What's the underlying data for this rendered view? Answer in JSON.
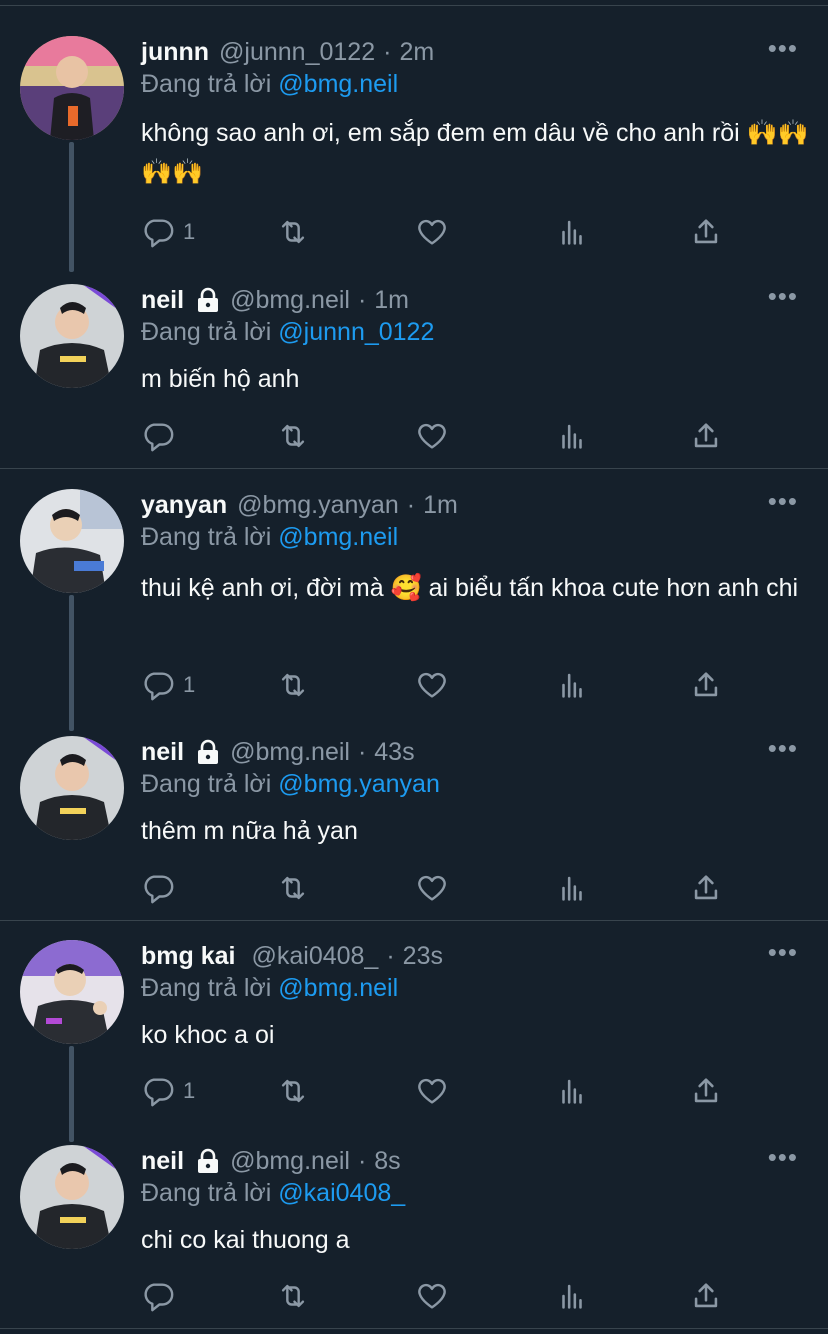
{
  "tweets": [
    {
      "name": "junnn",
      "locked": false,
      "handle": "@junnn_0122",
      "time": "2m",
      "reply_prefix": "Đang trả lời",
      "reply_to": "@bmg.neil",
      "text": "không sao anh ơi, em sắp đem em dâu về cho anh rồi 🙌🙌🙌🙌",
      "reply_count": "1",
      "avatar_colors": [
        "#d9c38f",
        "#5a3f7a",
        "#e86a2b"
      ]
    },
    {
      "name": "neil",
      "locked": true,
      "handle": "@bmg.neil",
      "time": "1m",
      "reply_prefix": "Đang trả lời",
      "reply_to": "@junnn_0122",
      "text": "m biến hộ anh",
      "reply_count": "",
      "avatar_colors": [
        "#cfd3d6",
        "#23262b",
        "#f2d25a"
      ]
    },
    {
      "name": "yanyan",
      "locked": false,
      "handle": "@bmg.yanyan",
      "time": "1m",
      "reply_prefix": "Đang trả lời",
      "reply_to": "@bmg.neil",
      "text": "thui kệ anh ơi, đời mà 🥰  ai biểu tấn khoa cute hơn anh chi",
      "reply_count": "1",
      "avatar_colors": [
        "#dfe2e6",
        "#2a2d33",
        "#4a7bd6"
      ]
    },
    {
      "name": "neil",
      "locked": true,
      "handle": "@bmg.neil",
      "time": "43s",
      "reply_prefix": "Đang trả lời",
      "reply_to": "@bmg.yanyan",
      "text": "thêm m nữa hả yan",
      "reply_count": "",
      "avatar_colors": [
        "#cfd3d6",
        "#23262b",
        "#f2d25a"
      ]
    },
    {
      "name": "bmg kai",
      "locked": false,
      "handle": "@kai0408_",
      "time": "23s",
      "reply_prefix": "Đang trả lời",
      "reply_to": "@bmg.neil",
      "text": "ko khoc a oi",
      "reply_count": "1",
      "avatar_colors": [
        "#e6e2ea",
        "#2a2d33",
        "#b34ad6"
      ]
    },
    {
      "name": "neil",
      "locked": true,
      "handle": "@bmg.neil",
      "time": "8s",
      "reply_prefix": "Đang trả lời",
      "reply_to": "@kai0408_",
      "text": "chi co kai thuong a",
      "reply_count": "",
      "avatar_colors": [
        "#cfd3d6",
        "#23262b",
        "#f2d25a"
      ]
    }
  ],
  "icons": {
    "more": "more-horizontal-icon",
    "reply": "reply-icon",
    "retweet": "retweet-icon",
    "like": "heart-icon",
    "stats": "analytics-icon",
    "share": "share-icon",
    "lock": "lock-icon"
  },
  "colors": {
    "background": "#15202b",
    "text": "#f7f9f9",
    "secondary": "#8b98a5",
    "mention": "#1d9bf0",
    "divider": "#38444d"
  }
}
